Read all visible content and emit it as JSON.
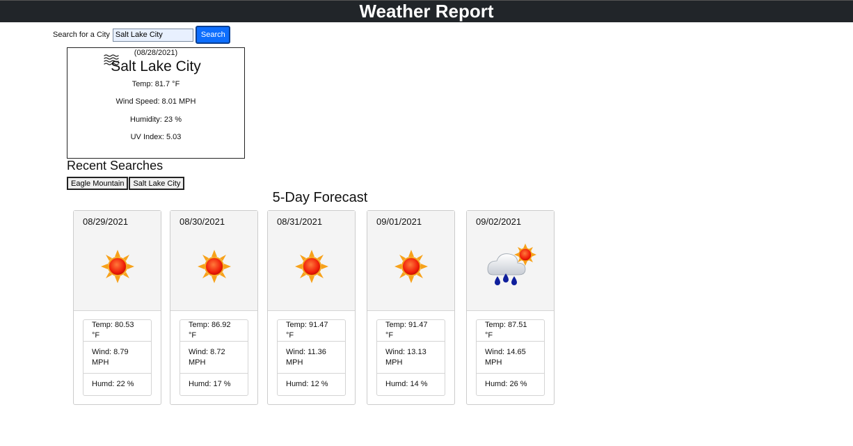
{
  "header": {
    "title": "Weather Report"
  },
  "search": {
    "label": "Search for a City",
    "value": "Salt Lake City",
    "button_label": "Search"
  },
  "current": {
    "icon": "wind-icon",
    "date": "(08/28/2021)",
    "city": "Salt Lake City",
    "temp": "Temp: 81.7 °F",
    "wind": "Wind Speed: 8.01 MPH",
    "humidity": "Humidity: 23 %",
    "uv": "UV Index: 5.03"
  },
  "recent": {
    "title": "Recent Searches",
    "items": [
      "Eagle Mountain",
      "Salt Lake City"
    ]
  },
  "forecast": {
    "title": "5-Day Forecast",
    "days": [
      {
        "date": "08/29/2021",
        "icon": "sunny-icon",
        "temp": "Temp: 80.53 °F",
        "wind_line1": "Wind: 8.79",
        "wind_line2": "MPH",
        "humidity": "Humd: 22 %"
      },
      {
        "date": "08/30/2021",
        "icon": "sunny-icon",
        "temp": "Temp: 86.92 °F",
        "wind_line1": "Wind: 8.72",
        "wind_line2": "MPH",
        "humidity": "Humd: 17 %"
      },
      {
        "date": "08/31/2021",
        "icon": "sunny-icon",
        "temp": "Temp: 91.47 °F",
        "wind_line1": "Wind: 11.36",
        "wind_line2": "MPH",
        "humidity": "Humd: 12 %"
      },
      {
        "date": "09/01/2021",
        "icon": "sunny-icon",
        "temp": "Temp: 91.47 °F",
        "wind_line1": "Wind: 13.13",
        "wind_line2": "MPH",
        "humidity": "Humd: 14 %"
      },
      {
        "date": "09/02/2021",
        "icon": "rain-sun-icon",
        "temp": "Temp: 87.51 °F",
        "wind_line1": "Wind: 14.65",
        "wind_line2": "MPH",
        "humidity": "Humd: 26 %"
      }
    ]
  },
  "colors": {
    "header_bg": "#212529",
    "button_blue": "#0d6efd",
    "sun_orange": "#f7a21b",
    "sun_red": "#f01a0a"
  }
}
